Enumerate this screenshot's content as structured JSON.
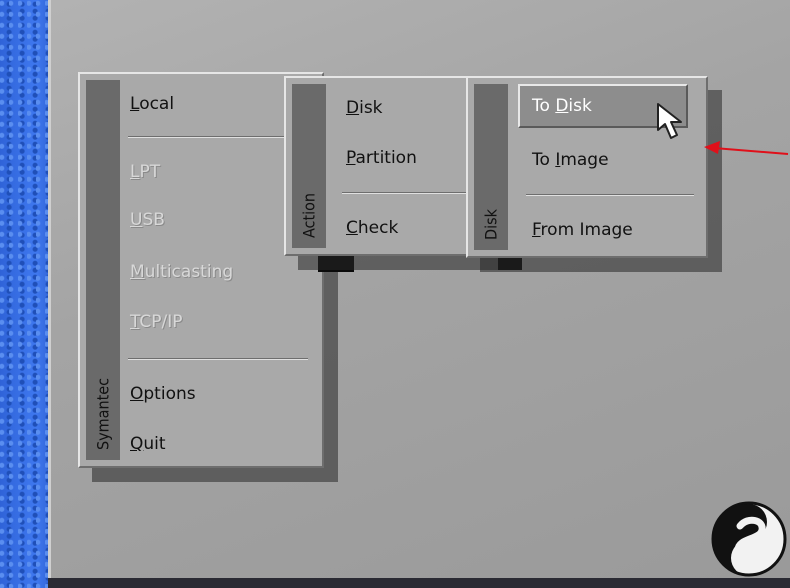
{
  "menus": {
    "symantec": {
      "title": "Symantec",
      "items": [
        {
          "label": "Local",
          "hotkey": "L"
        },
        {
          "label": "LPT",
          "hotkey": "L"
        },
        {
          "label": "USB",
          "hotkey": "U"
        },
        {
          "label": "Multicasting",
          "hotkey": "M"
        },
        {
          "label": "TCP/IP",
          "hotkey": "T"
        },
        {
          "label": "Options",
          "hotkey": "O"
        },
        {
          "label": "Quit",
          "hotkey": "Q"
        }
      ]
    },
    "action": {
      "title": "Action",
      "items": [
        {
          "label": "Disk",
          "hotkey": "D"
        },
        {
          "label": "Partition",
          "hotkey": "P"
        },
        {
          "label": "Check",
          "hotkey": "C"
        }
      ]
    },
    "disk": {
      "title": "Disk",
      "items": [
        {
          "label": "To Disk",
          "hotkey": "D"
        },
        {
          "label": "To Image",
          "hotkey": "I"
        },
        {
          "label": "From Image",
          "hotkey": "F"
        }
      ]
    }
  },
  "colors": {
    "menu_bg": "#a9a9a9",
    "title_bar": "#6a6a6a",
    "arrow": "#e0101a",
    "desktop": "#3f78ef"
  },
  "icons": {
    "cursor": "mouse-pointer-icon",
    "logo": "symantec-logo-icon",
    "annotation": "red-arrow-icon"
  }
}
